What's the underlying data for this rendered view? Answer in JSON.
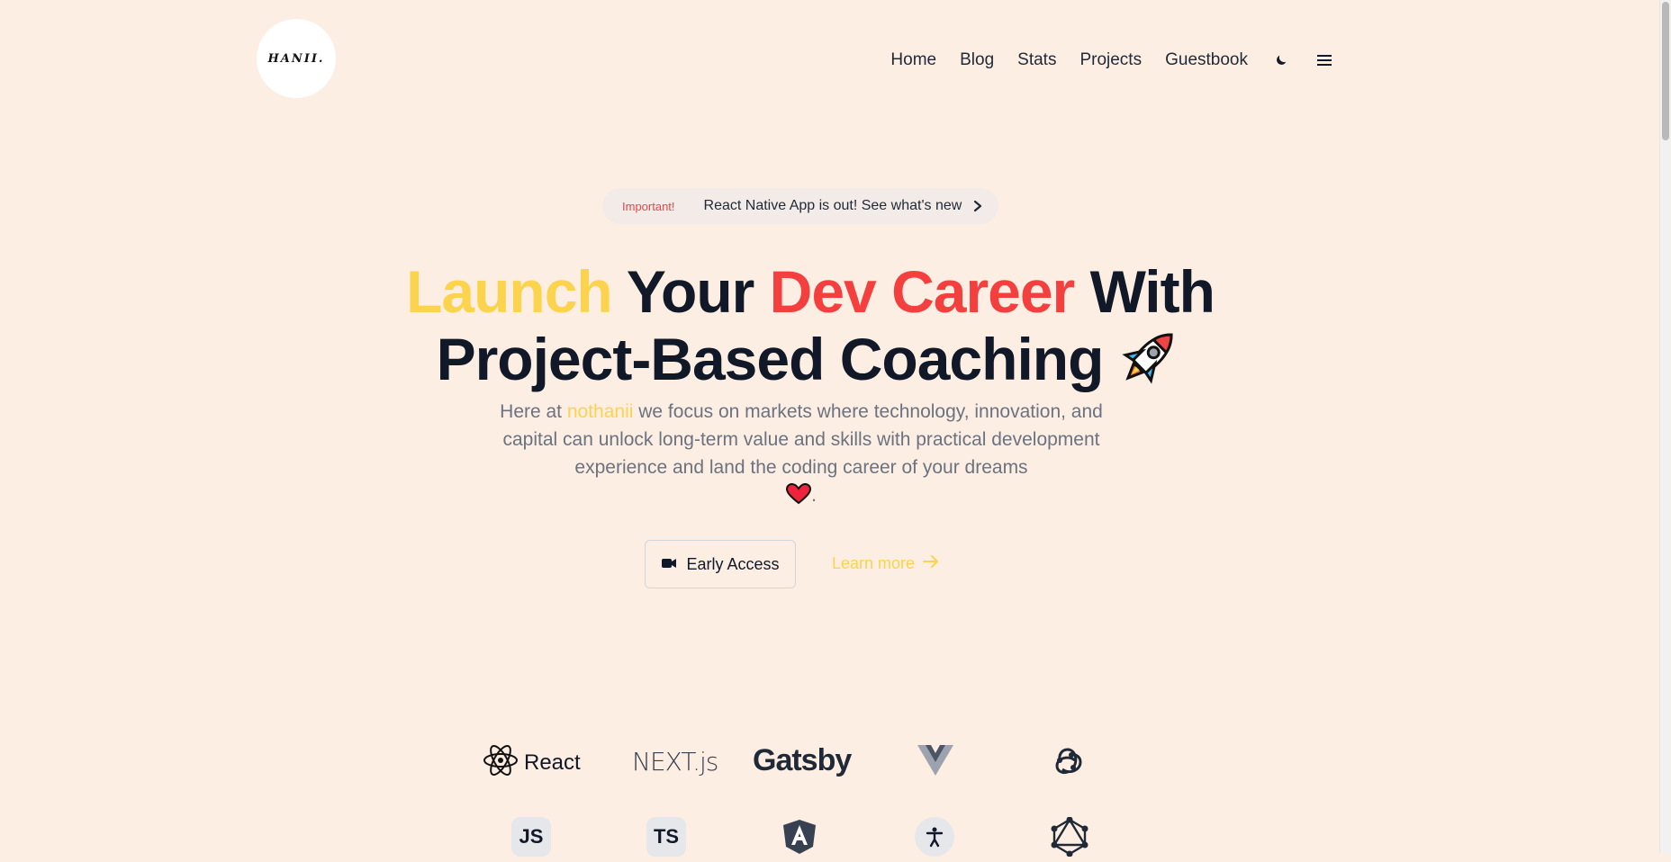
{
  "header": {
    "logo_text": "HANII.",
    "nav": [
      {
        "label": "Home"
      },
      {
        "label": "Blog"
      },
      {
        "label": "Stats"
      },
      {
        "label": "Projects"
      },
      {
        "label": "Guestbook"
      }
    ],
    "theme_icon": "moon-icon",
    "menu_icon": "hamburger-menu-icon"
  },
  "announcement": {
    "tag": "Important!",
    "message": "React Native App is out! See what's new",
    "icon": "chevron-right-icon"
  },
  "hero": {
    "title_part1": "Launch",
    "title_part2": " Your ",
    "title_part3": "Dev Career",
    "title_part4": " With",
    "title_line2": "Project-Based Coaching",
    "title_emoji": "rocket-icon",
    "subtitle_pre": "Here at ",
    "subtitle_brand": "nothanii",
    "subtitle_post": " we focus on markets where technology, innovation, and capital can unlock long-term value and skills with practical development experience and land the coding career of your dreams",
    "subtitle_end": ".",
    "subtitle_emoji": "heart-icon"
  },
  "actions": {
    "early_access_label": "Early Access",
    "early_access_icon": "video-camera-icon",
    "learn_more_label": "Learn more",
    "learn_more_icon": "arrow-right-icon"
  },
  "tech_logos": {
    "row1": [
      {
        "name": "React",
        "icon": "react-icon"
      },
      {
        "name": "NEXT.js",
        "icon": "nextjs-logo"
      },
      {
        "name": "Gatsby",
        "icon": "gatsby-logo"
      },
      {
        "name": "",
        "icon": "vue-icon"
      },
      {
        "name": "",
        "icon": "redux-icon"
      }
    ],
    "row2": [
      {
        "name": "JS",
        "icon": "javascript-icon"
      },
      {
        "name": "TS",
        "icon": "typescript-icon"
      },
      {
        "name": "",
        "icon": "angular-icon"
      },
      {
        "name": "",
        "icon": "accessibility-icon"
      },
      {
        "name": "",
        "icon": "graphql-icon"
      }
    ]
  },
  "colors": {
    "background": "#fdeee3",
    "accent_yellow": "#fcd34d",
    "accent_red": "#f43f3f",
    "text_dark": "#111827",
    "text_muted": "#6b7280"
  }
}
